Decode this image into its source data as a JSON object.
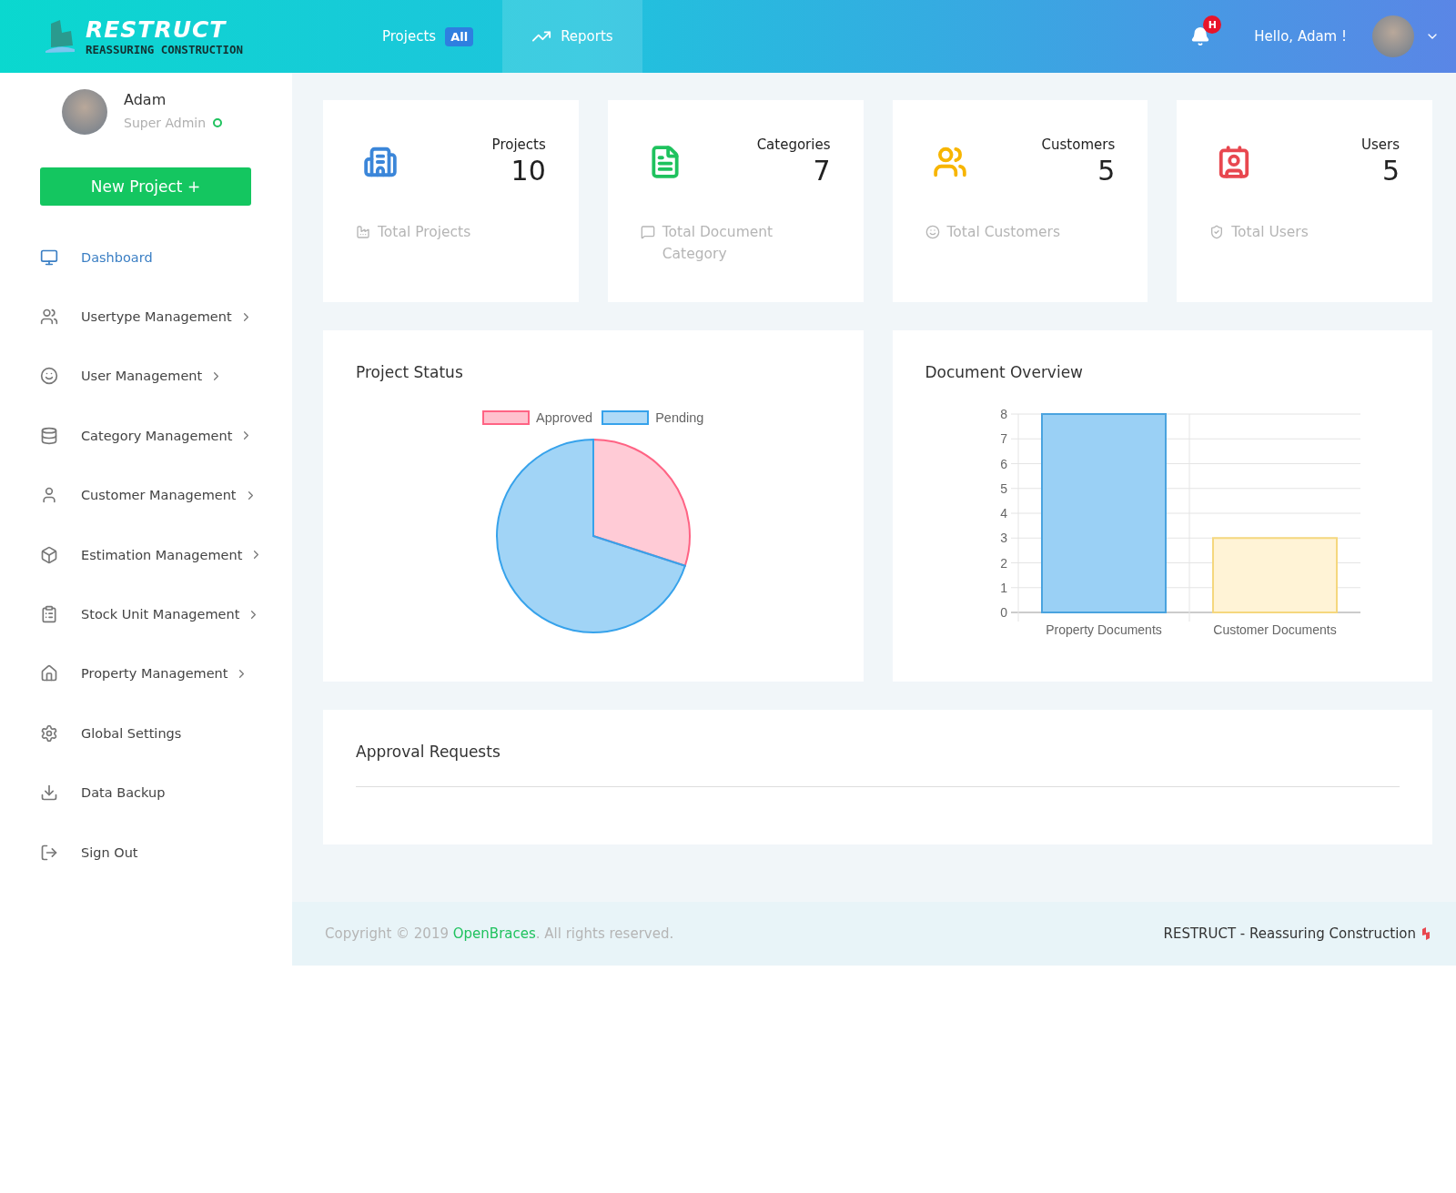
{
  "header": {
    "logo": {
      "name": "RESTRUCT",
      "tagline": "REASSURING CONSTRUCTION"
    },
    "nav": [
      {
        "label": "Projects",
        "badge": "All",
        "selected": false
      },
      {
        "label": "Reports",
        "selected": true
      }
    ],
    "notification_badge": "H",
    "greeting": "Hello, Adam !"
  },
  "sidebar": {
    "profile": {
      "name": "Adam",
      "role": "Super Admin",
      "online": true
    },
    "new_project_button": "New Project +",
    "items": [
      {
        "label": "Dashboard",
        "selected": true,
        "expandable": false
      },
      {
        "label": "Usertype Management",
        "selected": false,
        "expandable": true
      },
      {
        "label": "User Management",
        "selected": false,
        "expandable": true
      },
      {
        "label": "Category Management",
        "selected": false,
        "expandable": true
      },
      {
        "label": "Customer Management",
        "selected": false,
        "expandable": true
      },
      {
        "label": "Estimation Management",
        "selected": false,
        "expandable": true
      },
      {
        "label": "Stock Unit Management",
        "selected": false,
        "expandable": true
      },
      {
        "label": "Property Management",
        "selected": false,
        "expandable": true
      },
      {
        "label": "Global Settings",
        "selected": false,
        "expandable": false
      },
      {
        "label": "Data Backup",
        "selected": false,
        "expandable": false
      },
      {
        "label": "Sign Out",
        "selected": false,
        "expandable": false
      }
    ]
  },
  "stats": [
    {
      "title": "Projects",
      "value": "10",
      "caption": "Total Projects",
      "color": "#3b86d9"
    },
    {
      "title": "Categories",
      "value": "7",
      "caption": "Total Document Category",
      "color": "#1fc25e"
    },
    {
      "title": "Customers",
      "value": "5",
      "caption": "Total Customers",
      "color": "#f7b500"
    },
    {
      "title": "Users",
      "value": "5",
      "caption": "Total Users",
      "color": "#e8474f"
    }
  ],
  "project_status": {
    "title": "Project Status",
    "legend": [
      {
        "label": "Approved",
        "color": "#ff6384"
      },
      {
        "label": "Pending",
        "color": "#36a2eb"
      }
    ]
  },
  "document_overview": {
    "title": "Document Overview",
    "chart_data": {
      "type": "bar",
      "categories": [
        "Property Documents",
        "Customer Documents"
      ],
      "values": [
        8,
        3
      ],
      "ylim": [
        0,
        8
      ],
      "grid": true,
      "yticks": [
        0,
        1,
        2,
        3,
        4,
        5,
        6,
        7,
        8
      ]
    }
  },
  "approval_requests": {
    "title": "Approval Requests"
  },
  "footer": {
    "copyright_prefix": "Copyright © 2019 ",
    "company_link": "OpenBraces",
    "copyright_suffix": ". All rights reserved.",
    "brand": "RESTRUCT - Reassuring Construction"
  }
}
